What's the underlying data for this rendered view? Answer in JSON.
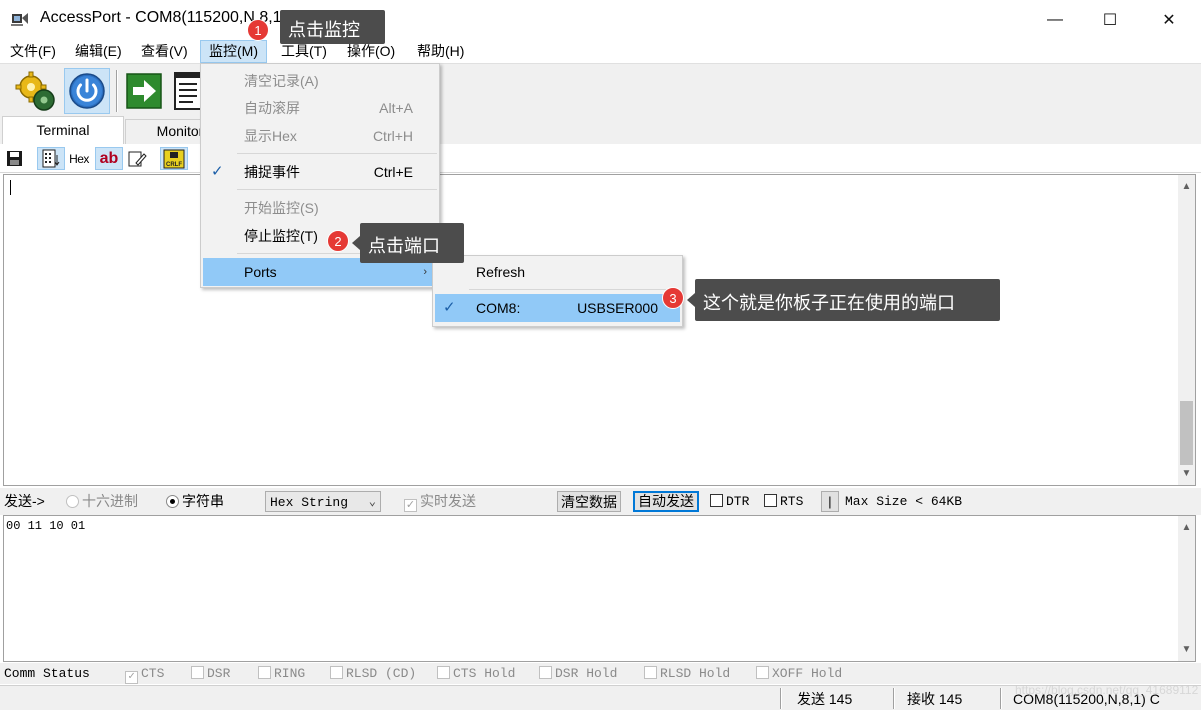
{
  "window": {
    "title": "AccessPort - COM8(115200,N,8,1) Opened",
    "minimize_glyph": "—",
    "maximize_glyph": "☐",
    "close_glyph": "✕"
  },
  "menubar": {
    "items": [
      "文件(F)",
      "编辑(E)",
      "查看(V)",
      "监控(M)",
      "工具(T)",
      "操作(O)",
      "帮助(H)"
    ],
    "active_index": 3
  },
  "toolbar": {
    "icons": [
      "settings-gear-icon",
      "power-icon",
      "arrow-right-icon",
      "document-icon"
    ]
  },
  "tabs": {
    "terminal": "Terminal",
    "monitor": "Monitor"
  },
  "subtoolbar": {
    "hex_label": "Hex",
    "ab_label": "ab",
    "crlf_label": "CRLF"
  },
  "monitor_menu": {
    "items": [
      {
        "label": "清空记录(A)",
        "shortcut": "",
        "enabled": false
      },
      {
        "label": "自动滚屏",
        "shortcut": "Alt+A",
        "enabled": false
      },
      {
        "label": "显示Hex",
        "shortcut": "Ctrl+H",
        "enabled": false
      },
      {
        "label": "捕捉事件",
        "shortcut": "Ctrl+E",
        "enabled": true,
        "checked": true
      },
      {
        "label": "开始监控(S)",
        "shortcut": "",
        "enabled": false
      },
      {
        "label": "停止监控(T)",
        "shortcut": "",
        "enabled": true
      },
      {
        "label": "Ports",
        "shortcut": "",
        "enabled": true,
        "submenu": true,
        "highlighted": true
      }
    ],
    "submenu_arrow": "›"
  },
  "ports_menu": {
    "refresh": "Refresh",
    "port_name": "COM8:",
    "port_device": "USBSER000",
    "port_checked": true
  },
  "annotations": [
    {
      "number": "1",
      "text": "点击监控"
    },
    {
      "number": "2",
      "text": "点击端口"
    },
    {
      "number": "3",
      "text": "这个就是你板子正在使用的端口"
    }
  ],
  "sendbar": {
    "send_label": "发送->",
    "hex_radio": "十六进制",
    "string_radio": "字符串",
    "string_selected": true,
    "format_select": "Hex String",
    "realtime_label": "实时发送",
    "clear_button": "清空数据",
    "auto_send_button": "自动发送",
    "dtr_label": "DTR",
    "rts_label": "RTS",
    "pipe": "|",
    "max_size": "Max Size < 64KB"
  },
  "send_area": {
    "text": "00 11 10 01"
  },
  "comm_status": {
    "label": "Comm Status",
    "signals": [
      {
        "name": "CTS",
        "checked": true
      },
      {
        "name": "DSR",
        "checked": false
      },
      {
        "name": "RING",
        "checked": false
      },
      {
        "name": "RLSD (CD)",
        "checked": false
      },
      {
        "name": "CTS Hold",
        "checked": false
      },
      {
        "name": "DSR Hold",
        "checked": false
      },
      {
        "name": "RLSD Hold",
        "checked": false
      },
      {
        "name": "XOFF Hold",
        "checked": false
      }
    ]
  },
  "statusbar": {
    "sent": "发送 145",
    "received": "接收 145",
    "port": "COM8(115200,N,8,1) C"
  },
  "watermark": "https://blog.csdn.net/qq_41689112"
}
